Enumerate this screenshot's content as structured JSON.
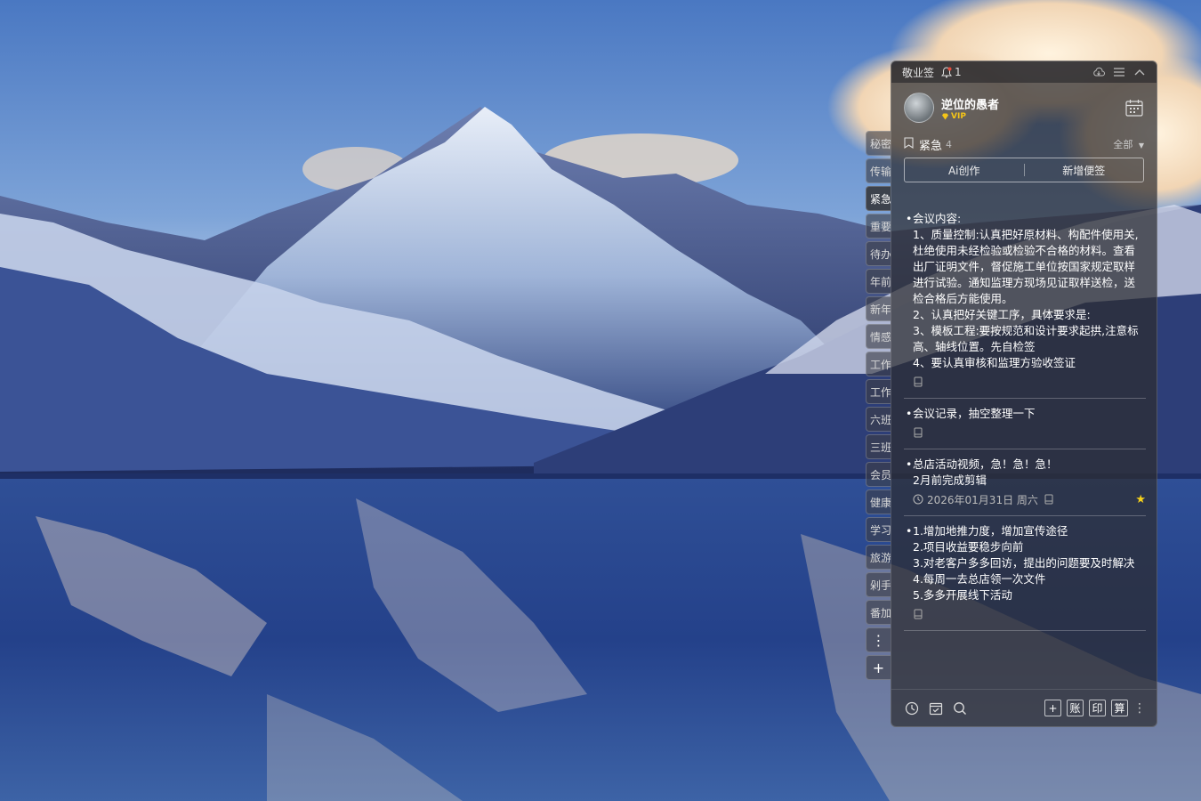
{
  "titlebar": {
    "app_name": "敬业签",
    "bell_count": "1"
  },
  "user": {
    "name": "逆位的愚者",
    "badge": "VIP"
  },
  "side_tabs": [
    {
      "label": "秘密",
      "active": false
    },
    {
      "label": "传输",
      "active": false
    },
    {
      "label": "紧急",
      "active": true
    },
    {
      "label": "重要",
      "active": false
    },
    {
      "label": "待办",
      "active": false
    },
    {
      "label": "年前",
      "active": false
    },
    {
      "label": "新年",
      "active": false
    },
    {
      "label": "情感",
      "active": false
    },
    {
      "label": "工作",
      "active": false
    },
    {
      "label": "工作",
      "active": false
    },
    {
      "label": "六班",
      "active": false
    },
    {
      "label": "三班",
      "active": false
    },
    {
      "label": "会员",
      "active": false
    },
    {
      "label": "健康",
      "active": false
    },
    {
      "label": "学习",
      "active": false
    },
    {
      "label": "旅游",
      "active": false
    },
    {
      "label": "剁手",
      "active": false
    },
    {
      "label": "番加",
      "active": false
    }
  ],
  "side_more": "⋮",
  "side_add": "+",
  "category": {
    "name": "紧急",
    "count": "4",
    "filter": "全部"
  },
  "actions": {
    "ai": "Ai创作",
    "new_note": "新增便签"
  },
  "notes": [
    {
      "text": "会议内容:\n1、质量控制:认真把好原材料、构配件使用关,杜绝使用未经检验或检验不合格的材料。查看出厂证明文件，督促施工单位按国家规定取样进行试验。通知监理方现场见证取样送检，送检合格后方能使用。\n2、认真把好关键工序，具体要求是:\n3、模板工程:要按规范和设计要求起拱,注意标高、轴线位置。先自检签\n4、要认真审核和监理方验收签证",
      "date": "",
      "starred": false
    },
    {
      "text": "会议记录，抽空整理一下",
      "date": "",
      "starred": false
    },
    {
      "text": "总店活动视频，急！急！急！\n2月前完成剪辑",
      "date": "2026年01月31日 周六",
      "starred": true
    },
    {
      "text": "1.增加地推力度，增加宣传途径\n2.项目收益要稳步向前\n3.对老客户多多回访，提出的问题要及时解决\n4.每周一去总店领一次文件\n5.多多开展线下活动",
      "date": "",
      "starred": false
    }
  ],
  "bottom_tools": {
    "account": "账",
    "print": "印",
    "calc": "算",
    "add": "+"
  }
}
